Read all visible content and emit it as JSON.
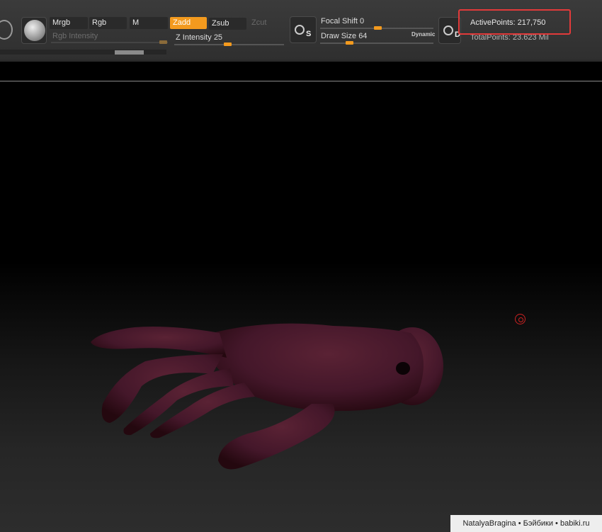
{
  "toolbar": {
    "modes": {
      "mrgb": "Mrgb",
      "rgb": "Rgb",
      "m": "M",
      "zadd": "Zadd",
      "zsub": "Zsub",
      "zcut": "Zcut"
    },
    "rgb_intensity": {
      "label": "Rgb Intensity"
    },
    "z_intensity": {
      "label": "Z Intensity",
      "value": "25"
    },
    "focal_shift": {
      "label": "Focal Shift",
      "value": "0"
    },
    "draw_size": {
      "label": "Draw Size",
      "value": "64"
    },
    "dynamic_label": "Dynamic",
    "stroke_icon_letter": "S",
    "draw_icon_letter": "D",
    "active_points": "ActivePoints: 217,750",
    "total_points": "TotalPoints: 23.623 Mil"
  },
  "watermark": "NatalyaBragina • Бэйбики • babiki.ru",
  "colors": {
    "accent": "#f39a1e",
    "highlight_box": "#e23a3a",
    "model": "#4a1a24"
  }
}
